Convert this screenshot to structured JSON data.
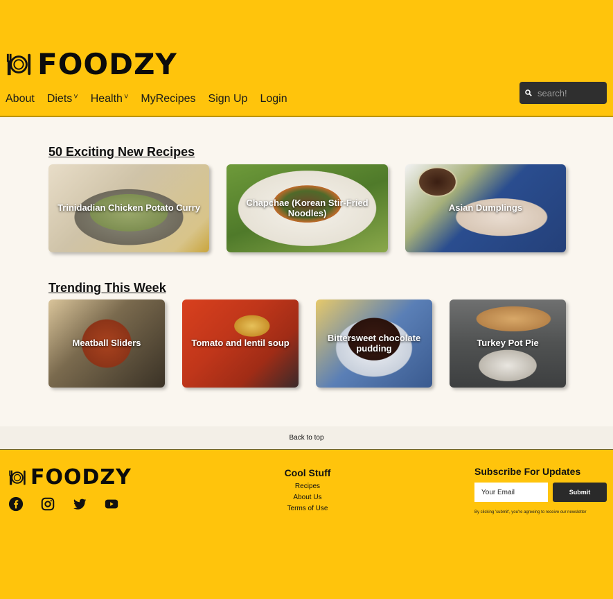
{
  "header": {
    "logo_text": "FOODZY",
    "search_placeholder": "search!",
    "nav": [
      {
        "label": "About",
        "dropdown": false
      },
      {
        "label": "Diets",
        "dropdown": true
      },
      {
        "label": "Health",
        "dropdown": true
      },
      {
        "label": "MyRecipes",
        "dropdown": false
      },
      {
        "label": "Sign Up",
        "dropdown": false
      },
      {
        "label": "Login",
        "dropdown": false
      }
    ],
    "caret": "˅"
  },
  "sections": [
    {
      "title": "50 Exciting New Recipes",
      "cards": [
        {
          "label": "Trinidadian Chicken Potato Curry"
        },
        {
          "label": "Chapchae (Korean Stir-Fried Noodles)"
        },
        {
          "label": "Asian Dumplings"
        }
      ]
    },
    {
      "title": "Trending This Week",
      "cards": [
        {
          "label": "Meatball Sliders"
        },
        {
          "label": "Tomato and lentil soup"
        },
        {
          "label": "Bittersweet chocolate pudding"
        },
        {
          "label": "Turkey Pot Pie"
        }
      ]
    }
  ],
  "back_to_top": "Back to top",
  "footer": {
    "logo_text": "FOODZY",
    "cool_title": "Cool Stuff",
    "links": [
      "Recipes",
      "About Us",
      "Terms of Use"
    ],
    "subscribe_title": "Subscribe For Updates",
    "email_placeholder": "Your Email",
    "submit_label": "Submit",
    "note": "By clicking 'submit', you're agreeing to receive our newsletter"
  },
  "colors": {
    "brand_yellow": "#ffc40c",
    "dark": "#2f2f2f",
    "page_bg": "#faf6ef"
  }
}
